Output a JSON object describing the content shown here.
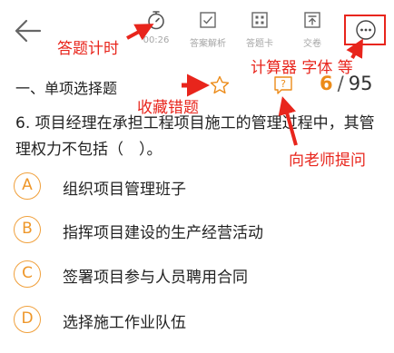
{
  "toolbar": {
    "timer_label": "00:26",
    "analysis_label": "答案解析",
    "answer_card_label": "答题卡",
    "submit_label": "交卷"
  },
  "section": {
    "title": "一、单项选择题"
  },
  "progress": {
    "current": "6",
    "separator": "/",
    "total": "95"
  },
  "question": {
    "text": "6. 项目经理在承担工程项目施工的管理过程中，其管理权力不包括（　）。"
  },
  "options": [
    {
      "letter": "A",
      "text": "组织项目管理班子"
    },
    {
      "letter": "B",
      "text": "指挥项目建设的生产经营活动"
    },
    {
      "letter": "C",
      "text": "签署项目参与人员聘用合同"
    },
    {
      "letter": "D",
      "text": "选择施工作业队伍"
    }
  ],
  "annotations": {
    "timer": "答题计时",
    "calculator": "计算器 字体 等",
    "favorite": "收藏错题",
    "ask_teacher": "向老师提问"
  },
  "colors": {
    "accent": "#ec8b19",
    "annotation": "#e8251c",
    "muted": "#a6a6a6"
  },
  "icons": [
    "back-arrow-icon",
    "stopwatch-icon",
    "analysis-icon",
    "answer-card-icon",
    "submit-icon",
    "more-icon",
    "star-icon",
    "ask-question-icon"
  ]
}
